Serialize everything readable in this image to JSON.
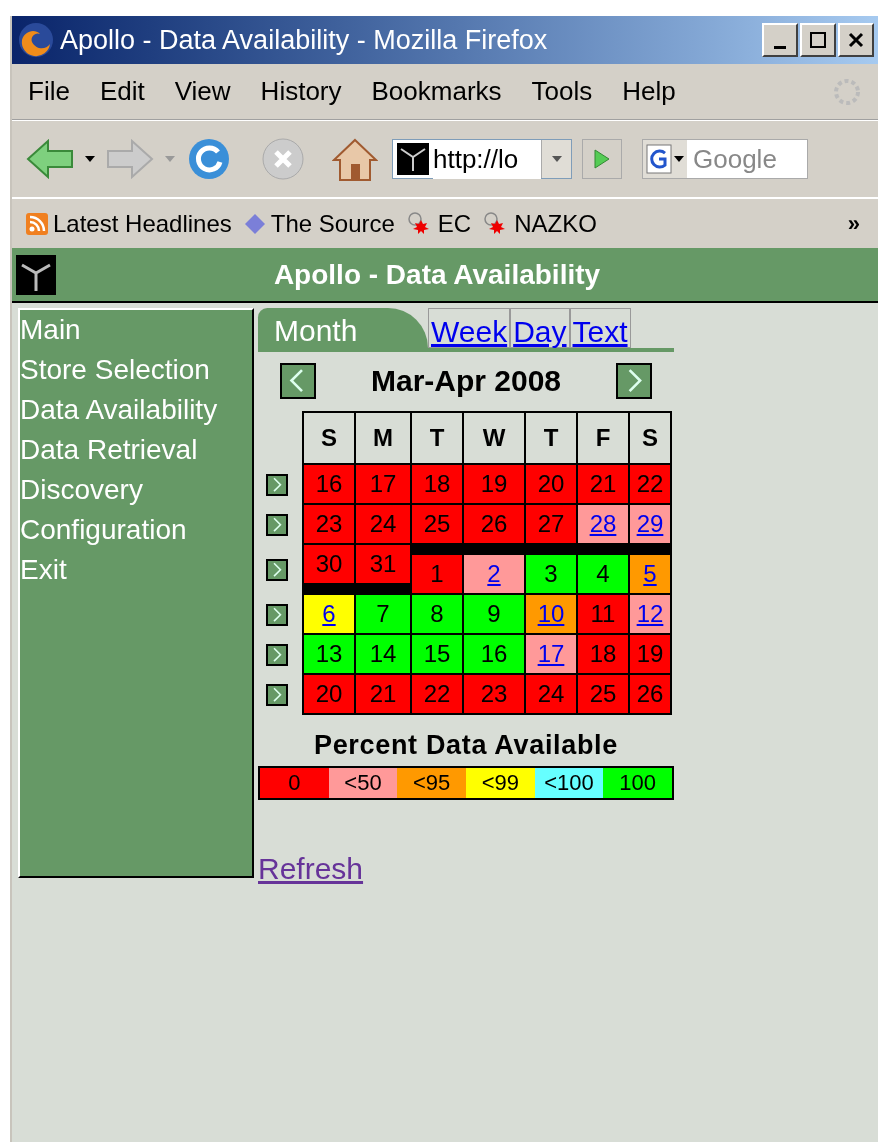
{
  "window": {
    "title": "Apollo - Data Availability - Mozilla Firefox"
  },
  "menu": [
    "File",
    "Edit",
    "View",
    "History",
    "Bookmarks",
    "Tools",
    "Help"
  ],
  "address": {
    "value": "http://lo"
  },
  "search": {
    "placeholder": "Google"
  },
  "bookmarks": [
    {
      "label": "Latest Headlines",
      "kind": "rss"
    },
    {
      "label": "The Source",
      "kind": "diamond"
    },
    {
      "label": "EC",
      "kind": "leaf"
    },
    {
      "label": "NAZKO",
      "kind": "leaf"
    }
  ],
  "bookmarks_more": "»",
  "page_title": "Apollo - Data Availability",
  "sidebar": {
    "items": [
      {
        "label": "Main"
      },
      {
        "label": "Store Selection"
      },
      {
        "label": "Data Availability"
      },
      {
        "label": "Data Retrieval"
      },
      {
        "label": "Discovery"
      },
      {
        "label": "Configuration"
      },
      {
        "label": "Exit"
      }
    ]
  },
  "tabs": [
    {
      "label": "Month",
      "selected": true
    },
    {
      "label": "Week",
      "selected": false
    },
    {
      "label": "Day",
      "selected": false
    },
    {
      "label": "Text",
      "selected": false
    }
  ],
  "calendar": {
    "title": "Mar-Apr 2008",
    "weekdays": [
      "S",
      "M",
      "T",
      "W",
      "T",
      "F",
      "S"
    ],
    "weeks": [
      {
        "days": [
          {
            "n": "16",
            "color": "#ff0000",
            "link": false
          },
          {
            "n": "17",
            "color": "#ff0000",
            "link": false
          },
          {
            "n": "18",
            "color": "#ff0000",
            "link": false
          },
          {
            "n": "19",
            "color": "#ff0000",
            "link": false
          },
          {
            "n": "20",
            "color": "#ff0000",
            "link": false
          },
          {
            "n": "21",
            "color": "#ff0000",
            "link": false
          },
          {
            "n": "22",
            "color": "#ff0000",
            "link": false
          }
        ]
      },
      {
        "days": [
          {
            "n": "23",
            "color": "#ff0000",
            "link": false
          },
          {
            "n": "24",
            "color": "#ff0000",
            "link": false
          },
          {
            "n": "25",
            "color": "#ff0000",
            "link": false
          },
          {
            "n": "26",
            "color": "#ff0000",
            "link": false
          },
          {
            "n": "27",
            "color": "#ff0000",
            "link": false
          },
          {
            "n": "28",
            "color": "#ff9999",
            "link": true
          },
          {
            "n": "29",
            "color": "#ff9999",
            "link": true
          }
        ]
      },
      {
        "days": [
          {
            "n": "30",
            "color": "#ff0000",
            "link": false,
            "offset": false
          },
          {
            "n": "31",
            "color": "#ff0000",
            "link": false,
            "offset": false
          },
          {
            "n": "1",
            "color": "#ff0000",
            "link": false,
            "offset": true
          },
          {
            "n": "2",
            "color": "#ff9999",
            "link": true,
            "offset": true
          },
          {
            "n": "3",
            "color": "#00ff00",
            "link": false,
            "offset": true
          },
          {
            "n": "4",
            "color": "#00ff00",
            "link": false,
            "offset": true
          },
          {
            "n": "5",
            "color": "#ff9900",
            "link": true,
            "offset": true
          }
        ]
      },
      {
        "days": [
          {
            "n": "6",
            "color": "#ffff00",
            "link": true
          },
          {
            "n": "7",
            "color": "#00ff00",
            "link": false
          },
          {
            "n": "8",
            "color": "#00ff00",
            "link": false
          },
          {
            "n": "9",
            "color": "#00ff00",
            "link": false
          },
          {
            "n": "10",
            "color": "#ff9900",
            "link": true
          },
          {
            "n": "11",
            "color": "#ff0000",
            "link": false
          },
          {
            "n": "12",
            "color": "#ff9999",
            "link": true
          }
        ]
      },
      {
        "days": [
          {
            "n": "13",
            "color": "#00ff00",
            "link": false
          },
          {
            "n": "14",
            "color": "#00ff00",
            "link": false
          },
          {
            "n": "15",
            "color": "#00ff00",
            "link": false
          },
          {
            "n": "16",
            "color": "#00ff00",
            "link": false
          },
          {
            "n": "17",
            "color": "#ff9999",
            "link": true
          },
          {
            "n": "18",
            "color": "#ff0000",
            "link": false
          },
          {
            "n": "19",
            "color": "#ff0000",
            "link": false
          }
        ]
      },
      {
        "days": [
          {
            "n": "20",
            "color": "#ff0000",
            "link": false
          },
          {
            "n": "21",
            "color": "#ff0000",
            "link": false
          },
          {
            "n": "22",
            "color": "#ff0000",
            "link": false
          },
          {
            "n": "23",
            "color": "#ff0000",
            "link": false
          },
          {
            "n": "24",
            "color": "#ff0000",
            "link": false
          },
          {
            "n": "25",
            "color": "#ff0000",
            "link": false
          },
          {
            "n": "26",
            "color": "#ff0000",
            "link": false
          }
        ]
      }
    ]
  },
  "legend": {
    "title": "Percent Data Available",
    "items": [
      {
        "label": "0",
        "color": "#ff0000"
      },
      {
        "label": "<50",
        "color": "#ff9999"
      },
      {
        "label": "<95",
        "color": "#ff9900"
      },
      {
        "label": "<99",
        "color": "#ffff00"
      },
      {
        "label": "<100",
        "color": "#66ffff"
      },
      {
        "label": "100",
        "color": "#00ff00"
      }
    ]
  },
  "refresh": "Refresh"
}
